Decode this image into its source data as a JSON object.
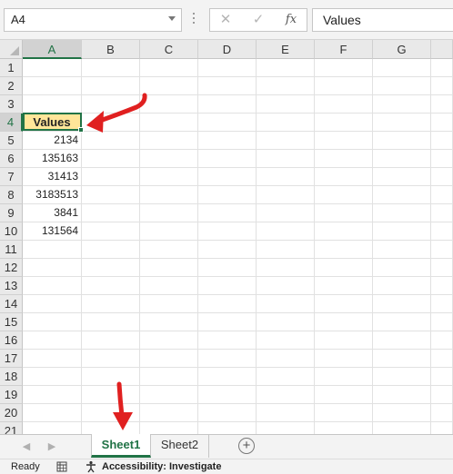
{
  "formula_bar": {
    "name_box": "A4",
    "formula_value": "Values",
    "cancel_glyph": "✕",
    "enter_glyph": "✓",
    "fx_glyph": "fx"
  },
  "columns": [
    "A",
    "B",
    "C",
    "D",
    "E",
    "F",
    "G"
  ],
  "selected_column": "A",
  "rows": [
    "1",
    "2",
    "3",
    "4",
    "5",
    "6",
    "7",
    "8",
    "9",
    "10",
    "11",
    "12",
    "13",
    "14",
    "15",
    "16",
    "17",
    "18",
    "19",
    "20",
    "21"
  ],
  "selected_row": "4",
  "cells": {
    "A4": "Values",
    "A5": "2134",
    "A6": "135163",
    "A7": "31413",
    "A8": "3183513",
    "A9": "3841",
    "A10": "131564"
  },
  "sheet_tabs": {
    "active": "Sheet1",
    "other": "Sheet2",
    "add_glyph": "+",
    "prev_glyph": "◀",
    "next_glyph": "▶"
  },
  "status_bar": {
    "ready": "Ready",
    "accessibility": "Accessibility: Investigate"
  },
  "colors": {
    "accent": "#217346",
    "header_fill": "#ffe699",
    "annotation_arrow": "#e02020"
  },
  "icons": {
    "name_box_dropdown": "chevron-down-icon",
    "cancel": "close-icon",
    "enter": "check-icon",
    "insert_function": "fx-icon",
    "corner": "select-all-icon",
    "add_sheet": "plus-circle-icon",
    "status_sheet": "sheet-view-icon",
    "accessibility": "accessibility-icon"
  }
}
